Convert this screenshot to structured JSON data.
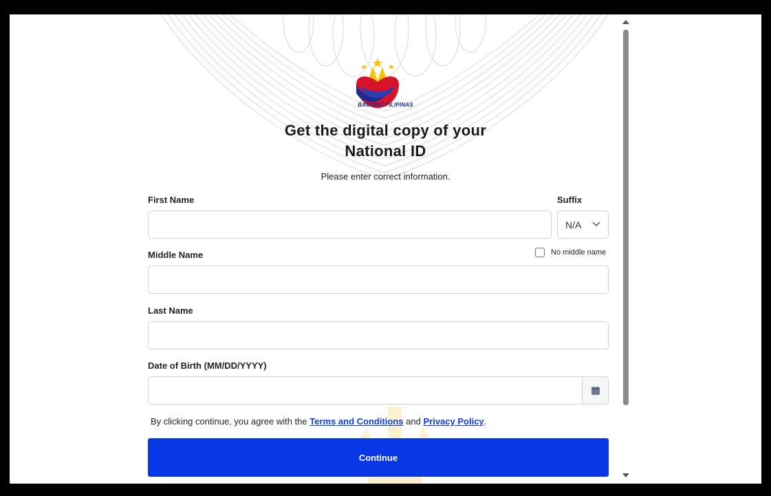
{
  "logo": {
    "text": "BAGONG PILIPINAS",
    "icon": "bagong-pilipinas-logo"
  },
  "header": {
    "title_line1": "Get the digital copy of your",
    "title_line2": "National ID",
    "subtitle": "Please enter correct information."
  },
  "form": {
    "first_name": {
      "label": "First Name",
      "value": "",
      "placeholder": ""
    },
    "suffix": {
      "label": "Suffix",
      "value": "N/A"
    },
    "middle_name": {
      "label": "Middle Name",
      "value": "",
      "placeholder": ""
    },
    "no_middle_name": {
      "label": "No middle name",
      "checked": false
    },
    "last_name": {
      "label": "Last Name",
      "value": "",
      "placeholder": ""
    },
    "dob": {
      "label": "Date of Birth (MM/DD/YYYY)",
      "value": "",
      "placeholder": ""
    }
  },
  "agreement": {
    "prefix": "By clicking continue, you agree with the",
    "terms_link": "Terms and Conditions",
    "conjunction": "and",
    "privacy_link": "Privacy Policy",
    "suffix": "."
  },
  "continue_button": {
    "label": "Continue"
  },
  "colors": {
    "primary": "#0a37e6",
    "link": "#0b3fd4",
    "border": "#cfd3d8"
  }
}
